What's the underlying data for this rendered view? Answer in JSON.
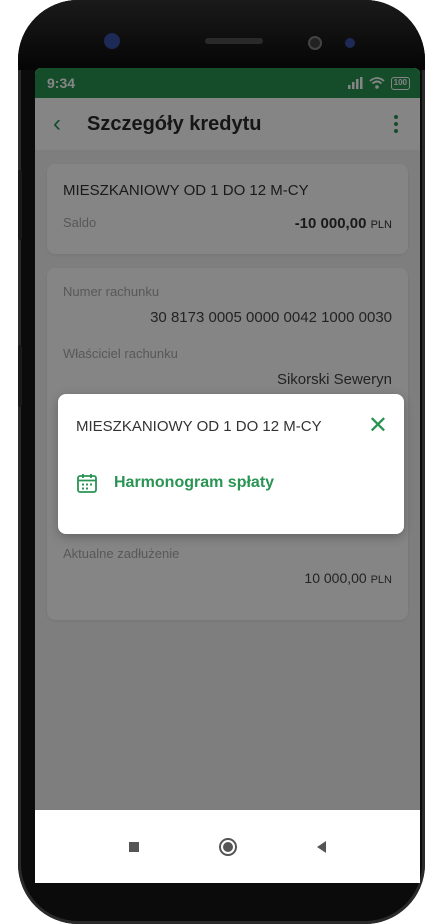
{
  "status_bar": {
    "time": "9:34",
    "battery": "100"
  },
  "header": {
    "title": "Szczegóły kredytu"
  },
  "summary": {
    "name": "MIESZKANIOWY OD 1 DO 12 M-CY",
    "balance_label": "Saldo",
    "balance_value": "-10 000,00",
    "balance_currency": "PLN"
  },
  "details": {
    "account_number_label": "Numer rachunku",
    "account_number": "30 8173 0005 0000 0042 1000 0030",
    "owner_label": "Właściciel rachunku",
    "owner_name": "Sikorski Seweryn",
    "debt_label": "Aktualne zadłużenie",
    "debt_value": "10 000,00",
    "debt_currency": "PLN"
  },
  "modal": {
    "title": "MIESZKANIOWY OD 1 DO 12 M-CY",
    "action_label": "Harmonogram spłaty"
  },
  "colors": {
    "accent": "#2a9454",
    "overlay": "rgba(0,0,0,0.48)"
  }
}
